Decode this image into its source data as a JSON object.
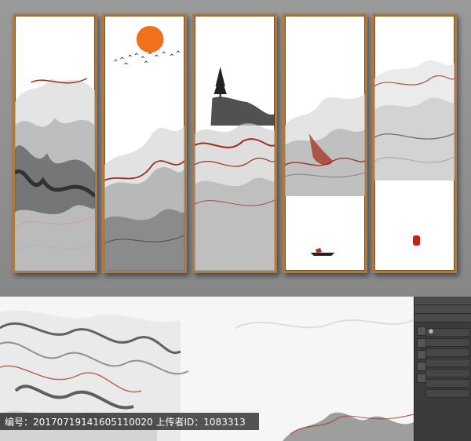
{
  "panels": [
    {
      "id": "panel-1",
      "motif": "ink-mountains"
    },
    {
      "id": "panel-2",
      "motif": "sun-and-birds"
    },
    {
      "id": "panel-3",
      "motif": "pine-on-peak"
    },
    {
      "id": "panel-4",
      "motif": "ink-mountains"
    },
    {
      "id": "panel-5",
      "motif": "red-seal"
    }
  ],
  "colors": {
    "frame": "#b07a3e",
    "sun": "#f0701c",
    "ink_red": "#a0301e",
    "ink_dark": "#2a2a2a",
    "seal": "#c0241c"
  },
  "footer": {
    "text": "编号：20170719141605110020 上传者ID：1083313"
  },
  "layers_panel": {
    "rows": [
      "",
      "",
      "",
      "",
      "",
      "",
      ""
    ]
  }
}
